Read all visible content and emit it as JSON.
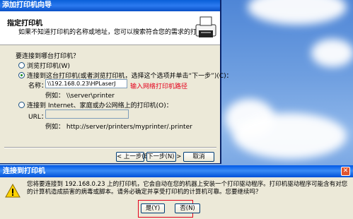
{
  "wizard": {
    "title": "添加打印机向导",
    "header_title": "指定打印机",
    "header_subtitle": "如果不知道打印机的名称或地址，您可以搜索符合您的需求的打印机。",
    "question": "要连接到哪台打印机？",
    "options": [
      {
        "label": "浏览打印机(W)",
        "selected": false
      },
      {
        "label": "连接到这台打印机(或者浏览打印机，选择这个选项并单击“下一步”)(C)：",
        "selected": true
      },
      {
        "label": "连接到 Internet、家庭或办公网络上的打印机(O)：",
        "selected": false
      }
    ],
    "name_label": "名称：",
    "name_value": "\\\\192.168.0.23\\HPLaserJ",
    "name_example": "例如： \\\\server\\printer",
    "annotation": "输入网络打印机路径",
    "url_label": "URL：",
    "url_value": "",
    "url_example": "例如： http://server/printers/myprinter/.printer",
    "buttons": {
      "back": "< 上一步(B)",
      "next": "下一步(N) >",
      "cancel": "取消"
    }
  },
  "dialog": {
    "title": "连接到打印机",
    "close": "✕",
    "message": "您将要连接到 192.168.0.23 上的打印机，它会自动在您的机器上安装一个打印驱动程序。打印机驱动程序可能含有对您的计算机造成损害的病毒或脚本。请务必确定并享受打印机的计算机可靠。您要继续吗？",
    "yes": "是(Y)",
    "no": "否(N)"
  },
  "colors": {
    "titlebar": "#0a5fd8",
    "annotation": "#e4001b",
    "dialog_bg": "#ece9d8"
  }
}
